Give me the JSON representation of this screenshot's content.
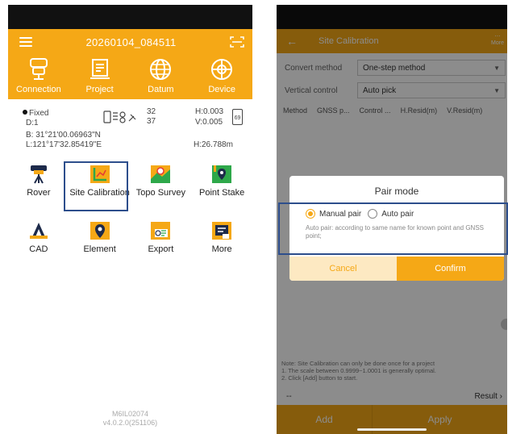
{
  "left": {
    "header_title": "20260104_084511",
    "nav": [
      {
        "label": "Connection",
        "icon": "receiver-icon"
      },
      {
        "label": "Project",
        "icon": "project-icon"
      },
      {
        "label": "Datum",
        "icon": "globe-icon"
      },
      {
        "label": "Device",
        "icon": "device-globe-icon"
      }
    ],
    "info": {
      "fix": "Fixed",
      "d": "D:1",
      "sat1": "32",
      "sat2": "37",
      "h": "H:0.003",
      "v": "V:0.005",
      "battery": "69",
      "lat": "B: 31°21'00.06963\"N",
      "lon": "L:121°17'32.85419\"E",
      "height": "H:26.788m"
    },
    "functions": [
      {
        "label": "Rover",
        "icon": "rover-icon"
      },
      {
        "label": "Site Calibration",
        "icon": "site-calibration-icon"
      },
      {
        "label": "Topo Survey",
        "icon": "topo-survey-icon"
      },
      {
        "label": "Point Stake",
        "icon": "point-stake-icon"
      },
      {
        "label": "CAD",
        "icon": "cad-icon"
      },
      {
        "label": "Element",
        "icon": "element-icon"
      },
      {
        "label": "Export",
        "icon": "export-icon"
      },
      {
        "label": "More",
        "icon": "more-icon"
      }
    ],
    "version_line1": "M6IL02074",
    "version_line2": "v4.0.2.0(251106)"
  },
  "right": {
    "title": "Site Calibration",
    "more_label": "More",
    "convert_label": "Convert method",
    "convert_value": "One-step method",
    "vertical_label": "Vertical control",
    "vertical_value": "Auto pick",
    "columns": [
      "Method",
      "GNSS p...",
      "Control ...",
      "H.Resid(m)",
      "V.Resid(m)"
    ],
    "note_lines": [
      "Note: Site Calibration can only be done once for a project",
      "1. The scale between 0.9999~1.0001 is generally optimal.",
      "2. Click [Add] button to start."
    ],
    "dash": "--",
    "result": "Result",
    "add": "Add",
    "apply": "Apply",
    "dialog": {
      "title": "Pair mode",
      "manual": "Manual pair",
      "auto": "Auto pair",
      "desc": "Auto pair: according to same name for known point and GNSS point;",
      "cancel": "Cancel",
      "confirm": "Confirm"
    }
  },
  "colors": {
    "accent": "#f5a816",
    "highlight_box": "#2d4e8c"
  }
}
